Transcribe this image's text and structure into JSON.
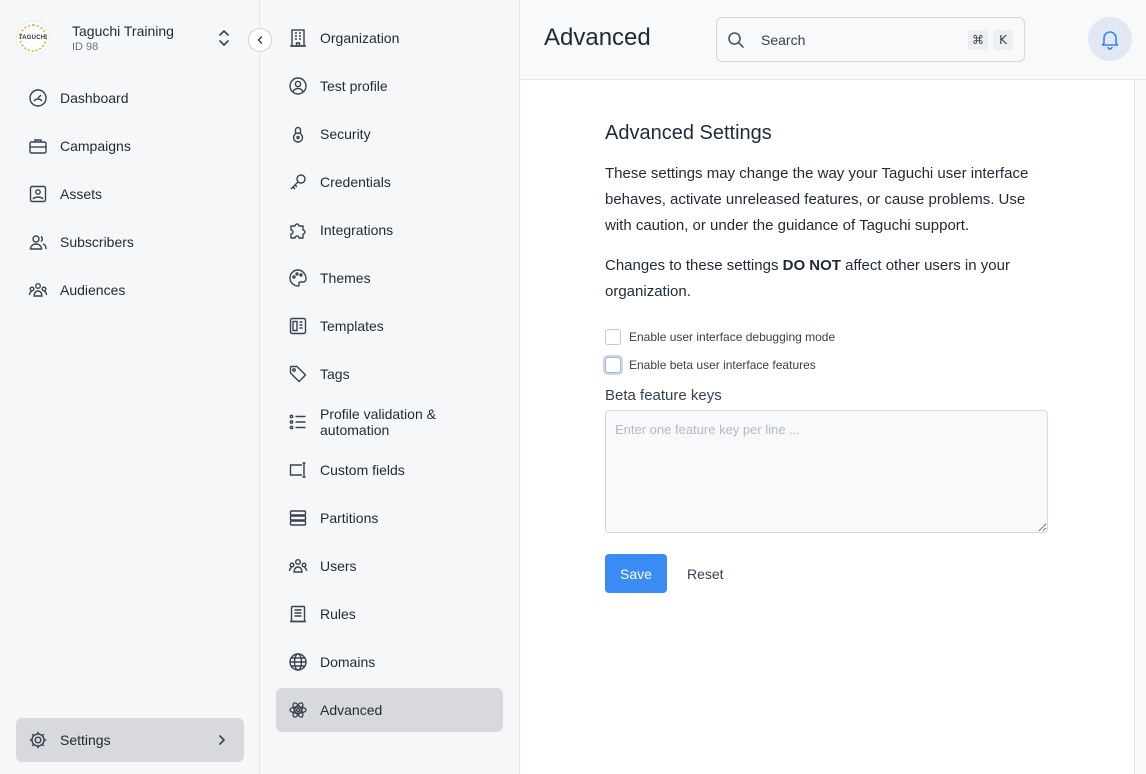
{
  "org": {
    "logo_text": "TAGUCHI",
    "name": "Taguchi Training",
    "id": "ID 98"
  },
  "nav": {
    "items": [
      {
        "label": "Dashboard",
        "icon": "dashboard-icon"
      },
      {
        "label": "Campaigns",
        "icon": "briefcase-icon"
      },
      {
        "label": "Assets",
        "icon": "image-icon"
      },
      {
        "label": "Subscribers",
        "icon": "user-group-icon"
      },
      {
        "label": "Audiences",
        "icon": "audience-icon"
      }
    ],
    "settings_label": "Settings"
  },
  "submenu": {
    "items": [
      {
        "label": "Organization",
        "icon": "building-icon"
      },
      {
        "label": "Test profile",
        "icon": "user-circle-icon"
      },
      {
        "label": "Security",
        "icon": "lock-icon"
      },
      {
        "label": "Credentials",
        "icon": "key-icon"
      },
      {
        "label": "Integrations",
        "icon": "puzzle-icon"
      },
      {
        "label": "Themes",
        "icon": "palette-icon"
      },
      {
        "label": "Templates",
        "icon": "template-icon"
      },
      {
        "label": "Tags",
        "icon": "tag-icon"
      },
      {
        "label": "Profile validation & automation",
        "icon": "list-icon"
      },
      {
        "label": "Custom fields",
        "icon": "custom-field-icon"
      },
      {
        "label": "Partitions",
        "icon": "stack-icon"
      },
      {
        "label": "Users",
        "icon": "users-icon"
      },
      {
        "label": "Rules",
        "icon": "document-icon"
      },
      {
        "label": "Domains",
        "icon": "globe-icon"
      },
      {
        "label": "Advanced",
        "icon": "atom-icon",
        "active": true
      }
    ]
  },
  "header": {
    "title": "Advanced",
    "search_placeholder": "Search",
    "shortcut_keys": [
      "⌘",
      "K"
    ]
  },
  "advanced": {
    "heading": "Advanced Settings",
    "description": "These settings may change the way your Taguchi user interface behaves, activate unreleased features, or cause problems. Use with caution, or under the guidance of Taguchi support.",
    "note_prefix": "Changes to these settings ",
    "note_bold": "DO NOT",
    "note_suffix": " affect other users in your organization.",
    "options": [
      {
        "label": "Enable user interface debugging mode",
        "checked": false
      },
      {
        "label": "Enable beta user interface features",
        "checked": false
      }
    ],
    "beta_keys_label": "Beta feature keys",
    "beta_keys_placeholder": "Enter one feature key per line ...",
    "beta_keys_value": "",
    "save_label": "Save",
    "reset_label": "Reset"
  },
  "colors": {
    "primary": "#3b8bf5",
    "active_bg": "#d7d9dc",
    "bell_bg": "#e2e8f2"
  }
}
